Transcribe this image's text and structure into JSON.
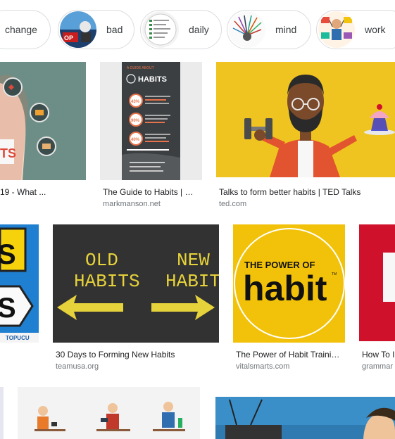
{
  "chips": [
    {
      "label": "change",
      "icon": "change-chip"
    },
    {
      "label": "bad",
      "icon": "bad-chip-thumbnail"
    },
    {
      "label": "daily",
      "icon": "daily-chip-thumbnail"
    },
    {
      "label": "mind",
      "icon": "mind-chip-thumbnail"
    },
    {
      "label": "work",
      "icon": "work-chip-thumbnail"
    }
  ],
  "results": {
    "r1": {
      "title": "19 - What ...",
      "source": ""
    },
    "r2": {
      "title": "The Guide to Habits | …",
      "source": "markmanson.net",
      "infographic": {
        "header": "A GUIDE ABOUT",
        "title": "HABITS",
        "stats": [
          "43%",
          "90%",
          "40%"
        ]
      }
    },
    "r3": {
      "title": "Talks to form better habits | TED Talks",
      "source": "ted.com"
    },
    "r4": {
      "title": "",
      "source": "",
      "sign_text": "S",
      "logo": "TOPUCU"
    },
    "r5": {
      "title": "30 Days to Forming New Habits",
      "source": "teamusa.org",
      "img_text": {
        "left1": "OLD",
        "left2": "HABITS",
        "right1": "NEW",
        "right2": "HABITS"
      }
    },
    "r6": {
      "title": "The Power of Habit Traini…",
      "source": "vitalsmarts.com",
      "img_text": {
        "line1": "THE POWER OF",
        "line2": "habit",
        "tm": "TM"
      }
    },
    "r7": {
      "title": "How To I",
      "source": "grammar"
    },
    "r8": {
      "title": "",
      "source": ""
    },
    "r9": {
      "title": "",
      "source": ""
    }
  },
  "colors": {
    "ted_yellow": "#f0c420",
    "vs_yellow": "#f2c20a",
    "board_dark": "#2e2e2e",
    "arrow_yellow": "#e6d23a",
    "sign_blue": "#1f7fd0",
    "sign_yellow": "#f5d20c",
    "red": "#d0112b"
  }
}
